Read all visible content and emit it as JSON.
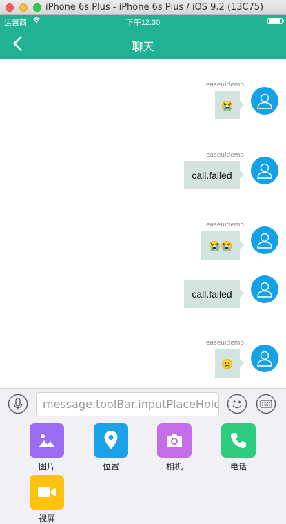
{
  "window": {
    "title": "iPhone 6s Plus - iPhone 6s Plus / iOS 9.2 (13C75)"
  },
  "status_bar": {
    "carrier": "运营商",
    "time": "下午12:30"
  },
  "nav": {
    "title": "聊天"
  },
  "messages": [
    {
      "nickname": "easeuidemo",
      "content": "😭",
      "type": "emoji"
    },
    {
      "nickname": "easeuidemo",
      "content": "call.failed",
      "type": "text"
    },
    {
      "nickname": "easeuidemo",
      "content": "😭😭",
      "type": "emoji"
    },
    {
      "nickname": "",
      "content": "call.failed",
      "type": "text"
    },
    {
      "nickname": "easeuidemo",
      "content": "😐",
      "type": "emoji"
    }
  ],
  "toolbar": {
    "input_placeholder": "message.toolBar.inputPlaceHolder"
  },
  "more_panel": {
    "items": [
      {
        "label": "图片",
        "icon": "picture-icon",
        "color": "#9b6cf2"
      },
      {
        "label": "位置",
        "icon": "location-icon",
        "color": "#1aa2e8"
      },
      {
        "label": "相机",
        "icon": "camera-icon",
        "color": "#c56de8"
      },
      {
        "label": "电话",
        "icon": "phone-icon",
        "color": "#2dcc7e"
      },
      {
        "label": "视屏",
        "icon": "video-icon",
        "color": "#ffc20e"
      }
    ]
  },
  "colors": {
    "primary": "#1fb394",
    "avatar": "#15a1e8",
    "bubble": "#d3e3e0"
  }
}
